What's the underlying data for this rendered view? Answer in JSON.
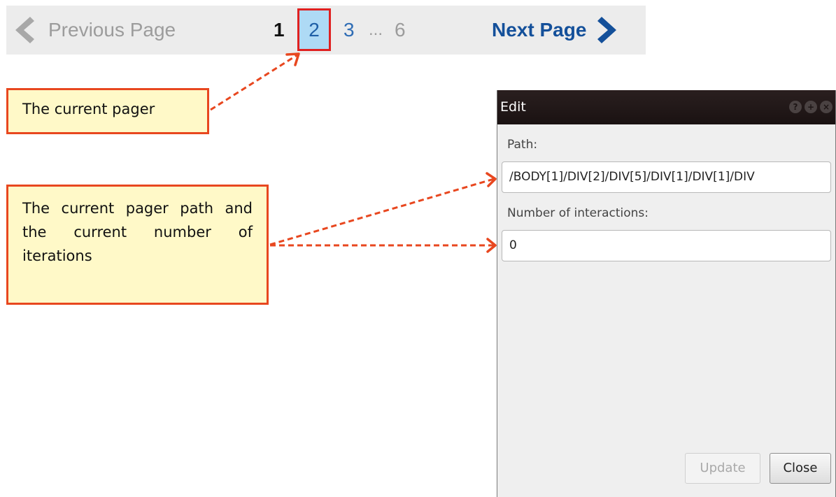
{
  "pager": {
    "previous_label": "Previous Page",
    "current_page": "1",
    "selected_page": "2",
    "page_3": "3",
    "ellipsis": "...",
    "last_page": "6",
    "next_label": "Next Page"
  },
  "callouts": {
    "current_pager": "The current pager",
    "pager_path": "The current pager path and the current number of iterations"
  },
  "dialog": {
    "title": "Edit",
    "title_icons": [
      "help-icon",
      "plus-icon",
      "close-icon"
    ],
    "path_label": "Path:",
    "path_value": "/BODY[1]/DIV[2]/DIV[5]/DIV[1]/DIV[1]/DIV",
    "number_label": "Number of interactions:",
    "number_value": "0",
    "update_label": "Update",
    "close_label": "Close"
  },
  "colors": {
    "accent": "#e8471f",
    "callout_fill": "#fff9c8",
    "selected_page_fill": "#aedaf5",
    "next_link": "#14509a"
  }
}
